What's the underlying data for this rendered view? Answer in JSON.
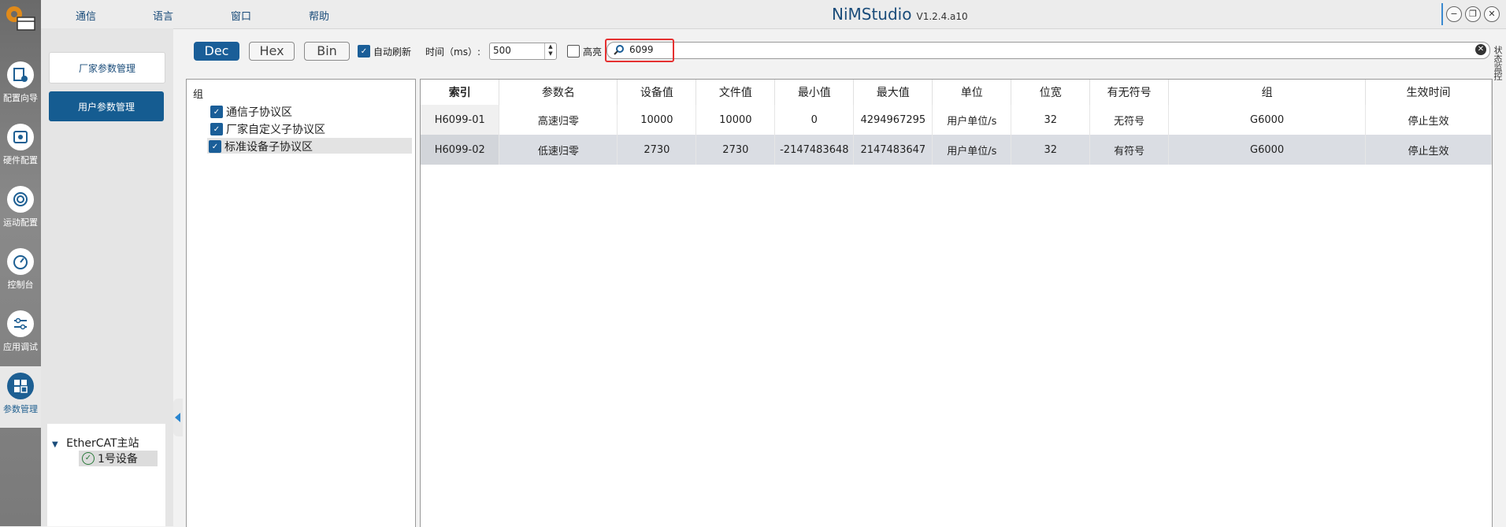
{
  "app": {
    "title": "NiMStudio",
    "version": "V1.2.4.a10"
  },
  "menu": [
    "通信",
    "语言",
    "窗口",
    "帮助"
  ],
  "nav": [
    {
      "label": "配置向导",
      "icon": "config-wizard-icon"
    },
    {
      "label": "硬件配置",
      "icon": "hardware-icon"
    },
    {
      "label": "运动配置",
      "icon": "motion-icon"
    },
    {
      "label": "控制台",
      "icon": "gauge-icon"
    },
    {
      "label": "应用调试",
      "icon": "sliders-icon"
    },
    {
      "label": "参数管理",
      "icon": "param-icon",
      "active": true
    }
  ],
  "left_panel": {
    "vendor_btn": "厂家参数管理",
    "user_btn": "用户参数管理"
  },
  "tree": {
    "root": "EtherCAT主站",
    "child": "1号设备"
  },
  "toolbar": {
    "dec": "Dec",
    "hex": "Hex",
    "bin": "Bin",
    "auto_refresh": "自动刷新",
    "interval_label": "时间（ms）:",
    "interval_value": "500",
    "highlight": "高亮",
    "search_value": "6099"
  },
  "side_tab": "状态监控",
  "groups": {
    "title": "组",
    "items": [
      {
        "label": "通信子协议区",
        "checked": true
      },
      {
        "label": "厂家自定义子协议区",
        "checked": true
      },
      {
        "label": "标准设备子协议区",
        "checked": true
      }
    ]
  },
  "table": {
    "headers": [
      "索引",
      "参数名",
      "设备值",
      "文件值",
      "最小值",
      "最大值",
      "单位",
      "位宽",
      "有无符号",
      "组",
      "生效时间"
    ],
    "rows": [
      [
        "H6099-01",
        "高速归零",
        "10000",
        "10000",
        "0",
        "4294967295",
        "用户单位/s",
        "32",
        "无符号",
        "G6000",
        "停止生效"
      ],
      [
        "H6099-02",
        "低速归零",
        "2730",
        "2730",
        "-2147483648",
        "2147483647",
        "用户单位/s",
        "32",
        "有符号",
        "G6000",
        "停止生效"
      ]
    ]
  },
  "colors": {
    "accent": "#1a5e98",
    "highlight_border": "#e53030"
  }
}
